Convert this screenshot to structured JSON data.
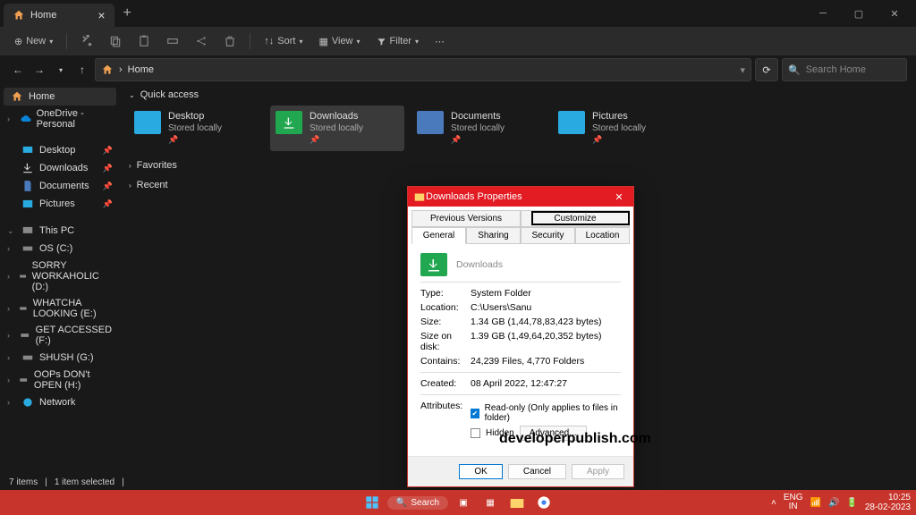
{
  "titlebar": {
    "tab_label": "Home"
  },
  "toolbar": {
    "new": "New",
    "sort": "Sort",
    "view": "View",
    "filter": "Filter"
  },
  "address": {
    "crumb": "Home",
    "search_placeholder": "Search Home"
  },
  "sidebar": {
    "home": "Home",
    "onedrive": "OneDrive - Personal",
    "desktop": "Desktop",
    "downloads": "Downloads",
    "documents": "Documents",
    "pictures": "Pictures",
    "thispc": "This PC",
    "drives": [
      "OS (C:)",
      "SORRY WORKAHOLIC (D:)",
      "WHATCHA LOOKING (E:)",
      "GET ACCESSED (F:)",
      "SHUSH (G:)",
      "OOPs DON't OPEN (H:)"
    ],
    "network": "Network"
  },
  "content": {
    "quick": "Quick access",
    "items": [
      {
        "name": "Desktop",
        "sub": "Stored locally"
      },
      {
        "name": "Downloads",
        "sub": "Stored locally"
      },
      {
        "name": "Documents",
        "sub": "Stored locally"
      },
      {
        "name": "Pictures",
        "sub": "Stored locally"
      }
    ],
    "favorites": "Favorites",
    "recent": "Recent"
  },
  "status": {
    "items": "7 items",
    "selected": "1 item selected"
  },
  "dialog": {
    "title": "Downloads Properties",
    "tabs": [
      "Previous Versions",
      "Customize",
      "General",
      "Sharing",
      "Security",
      "Location"
    ],
    "name": "Downloads",
    "rows": {
      "type_l": "Type:",
      "type_v": "System Folder",
      "loc_l": "Location:",
      "loc_v": "C:\\Users\\Sanu",
      "size_l": "Size:",
      "size_v": "1.34 GB (1,44,78,83,423 bytes)",
      "sod_l": "Size on disk:",
      "sod_v": "1.39 GB (1,49,64,20,352 bytes)",
      "cont_l": "Contains:",
      "cont_v": "24,239 Files, 4,770 Folders",
      "created_l": "Created:",
      "created_v": "08 April 2022, 12:47:27",
      "attr_l": "Attributes:",
      "readonly": "Read-only (Only applies to files in folder)",
      "hidden": "Hidden",
      "advanced": "Advanced..."
    },
    "buttons": {
      "ok": "OK",
      "cancel": "Cancel",
      "apply": "Apply"
    }
  },
  "taskbar": {
    "search": "Search",
    "lang": "ENG",
    "region": "IN",
    "time": "10:25",
    "date": "28-02-2023"
  },
  "watermark": "developerpublish.com"
}
